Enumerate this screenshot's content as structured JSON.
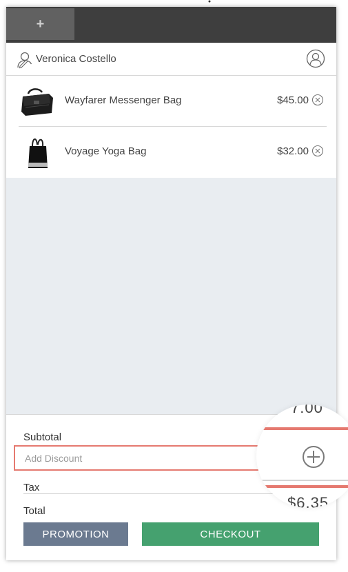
{
  "tabs": {
    "add_label": "+"
  },
  "customer": {
    "name": "Veronica Costello"
  },
  "cart": {
    "items": [
      {
        "name": "Wayfarer Messenger Bag",
        "price": "$45.00"
      },
      {
        "name": "Voyage Yoga Bag",
        "price": "$32.00"
      }
    ]
  },
  "summary": {
    "subtotal_label": "Subtotal",
    "discount_placeholder": "Add Discount",
    "tax_label": "Tax",
    "total_label": "Total"
  },
  "buttons": {
    "promotion": "PROMOTION",
    "checkout": "CHECKOUT"
  },
  "magnifier": {
    "top_value": "7.00",
    "bottom_value": "$6.35"
  },
  "colors": {
    "topbar": "#3e3e3e",
    "highlight": "#e5796f",
    "promotion": "#6b7a90",
    "checkout": "#45a16f",
    "empty_area": "#e9edf1"
  },
  "icons": {
    "customer": "user-edit-icon",
    "profile": "user-circle-icon",
    "remove": "circle-x-icon",
    "add_discount": "circle-plus-icon"
  }
}
